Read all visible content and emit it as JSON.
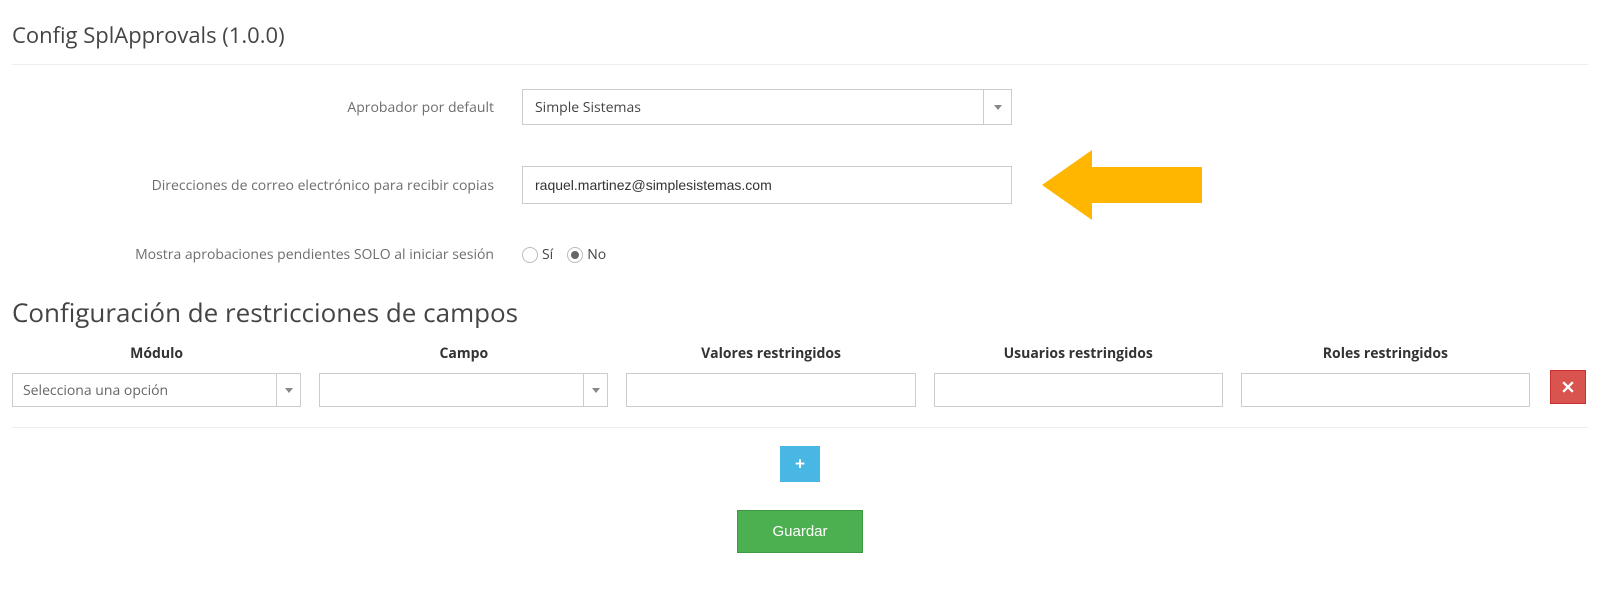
{
  "page_title": "Config SplApprovals (1.0.0)",
  "form": {
    "default_approver": {
      "label": "Aprobador por default",
      "selected": "Simple Sistemas"
    },
    "copy_emails": {
      "label": "Direcciones de correo electrónico para recibir copias",
      "value": "raquel.martinez@simplesistemas.com"
    },
    "show_pending": {
      "label": "Mostra aprobaciones pendientes SOLO al iniciar sesión",
      "yes": "Sí",
      "no": "No",
      "selected": "No"
    }
  },
  "restrictions": {
    "title": "Configuración de restricciones de campos",
    "headers": {
      "module": "Módulo",
      "field": "Campo",
      "restricted_values": "Valores restringidos",
      "restricted_users": "Usuarios restringidos",
      "restricted_roles": "Roles restringidos"
    },
    "module_placeholder": "Selecciona una opción"
  },
  "buttons": {
    "save": "Guardar"
  },
  "colors": {
    "save_green": "#4caf50",
    "add_blue": "#48b7e4",
    "delete_red": "#d9534f",
    "arrow_yellow": "#ffb600"
  }
}
